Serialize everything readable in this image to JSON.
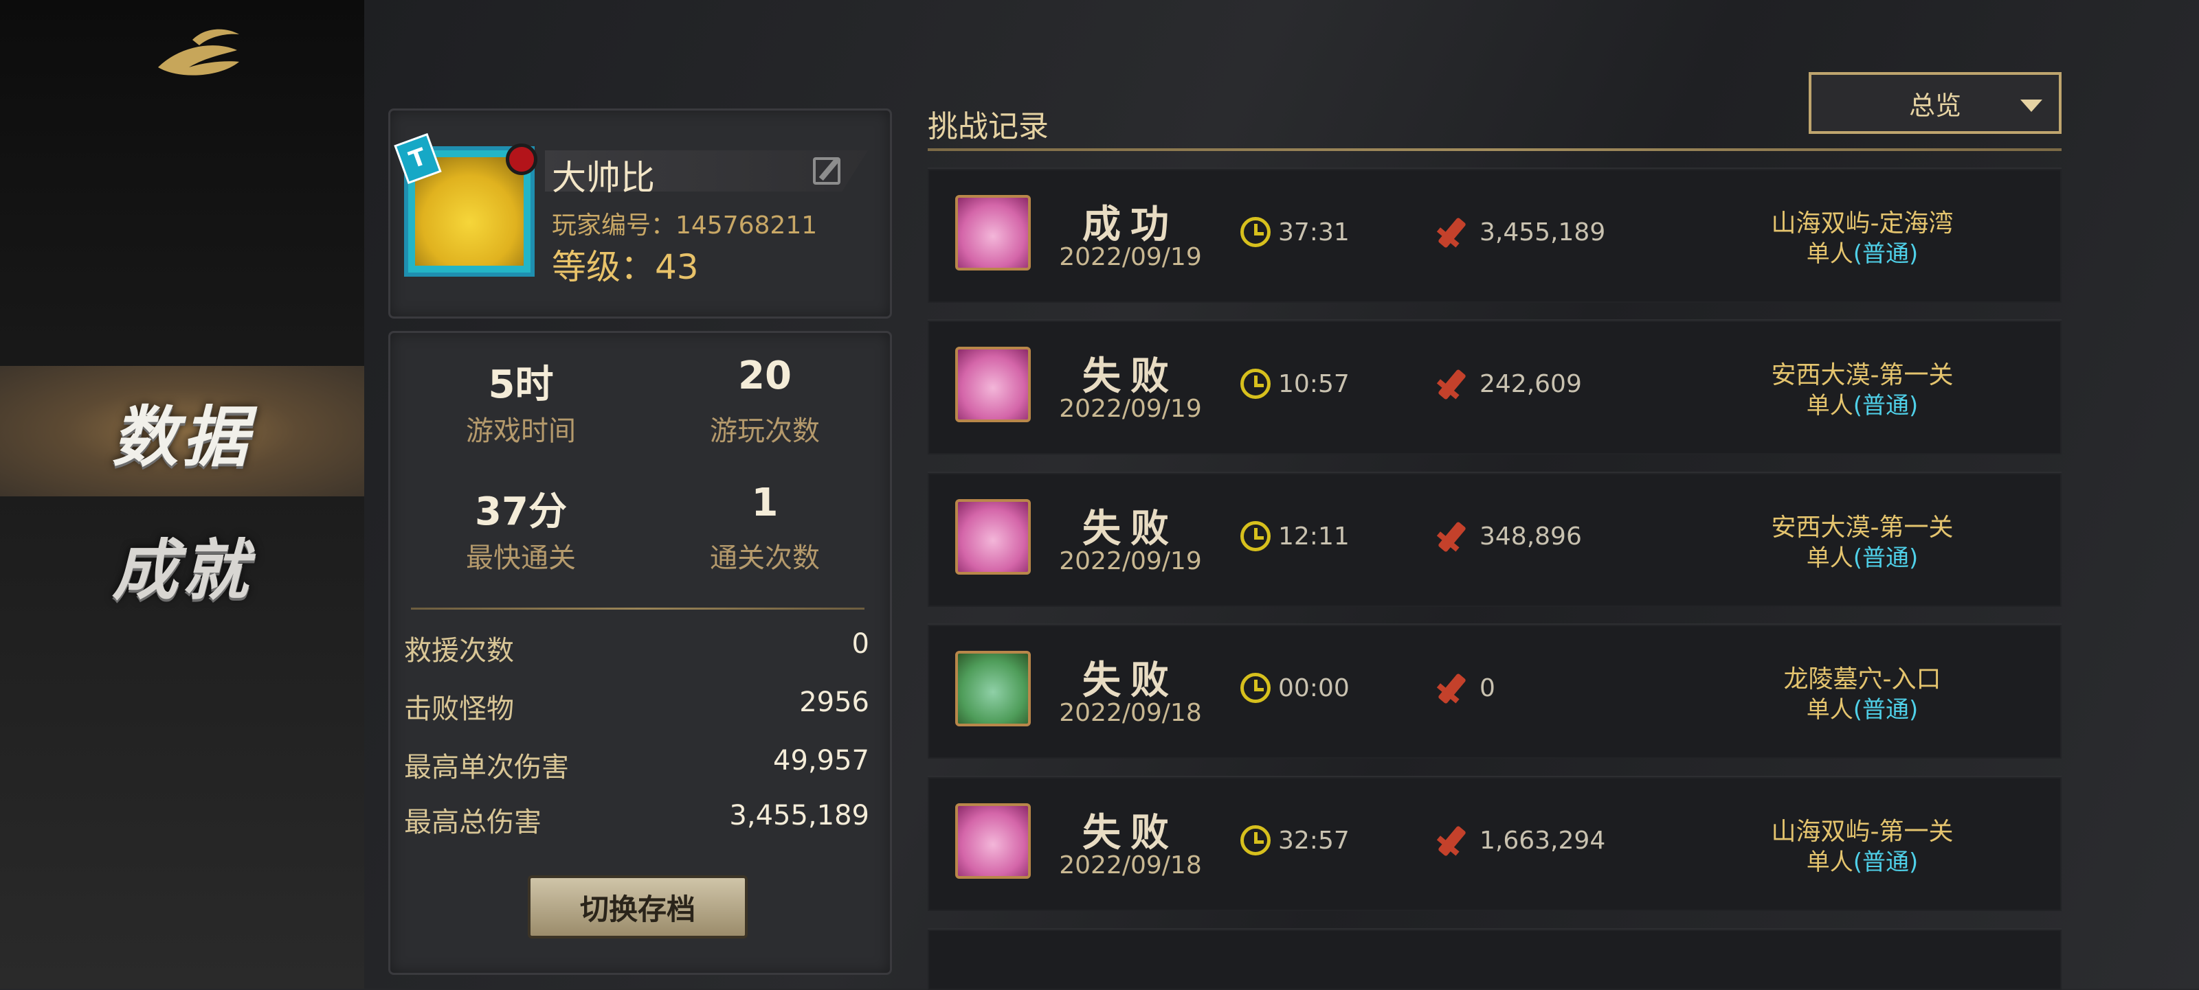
{
  "nav": {
    "data_label": "数据",
    "achievement_label": "成就"
  },
  "profile": {
    "name": "大帅比",
    "player_id": "玩家编号：145768211",
    "level": "等级：43",
    "avatar_tag": "T"
  },
  "stats": {
    "play_time": {
      "value": "5时",
      "label": "游戏时间"
    },
    "play_count": {
      "value": "20",
      "label": "游玩次数"
    },
    "fastest_clear": {
      "value": "37分",
      "label": "最快通关"
    },
    "clear_count": {
      "value": "1",
      "label": "通关次数"
    },
    "rows": [
      {
        "label": "救援次数",
        "value": "0"
      },
      {
        "label": "击败怪物",
        "value": "2956"
      },
      {
        "label": "最高单次伤害",
        "value": "49,957"
      },
      {
        "label": "最高总伤害",
        "value": "3,455,189"
      }
    ],
    "switch_button": "切换存档"
  },
  "records": {
    "title": "挑战记录",
    "filter": "总览",
    "items": [
      {
        "result": "成功",
        "date": "2022/09/19",
        "time": "37:31",
        "damage": "3,455,189",
        "stage": "山海双屿-定海湾",
        "mode_prefix": "单人",
        "mode": "(普通)",
        "avatar": "pink"
      },
      {
        "result": "失败",
        "date": "2022/09/19",
        "time": "10:57",
        "damage": "242,609",
        "stage": "安西大漠-第一关",
        "mode_prefix": "单人",
        "mode": "(普通)",
        "avatar": "pink"
      },
      {
        "result": "失败",
        "date": "2022/09/19",
        "time": "12:11",
        "damage": "348,896",
        "stage": "安西大漠-第一关",
        "mode_prefix": "单人",
        "mode": "(普通)",
        "avatar": "pink"
      },
      {
        "result": "失败",
        "date": "2022/09/18",
        "time": "00:00",
        "damage": "0",
        "stage": "龙陵墓穴-入口",
        "mode_prefix": "单人",
        "mode": "(普通)",
        "avatar": "green"
      },
      {
        "result": "失败",
        "date": "2022/09/18",
        "time": "32:57",
        "damage": "1,663,294",
        "stage": "山海双屿-第一关",
        "mode_prefix": "单人",
        "mode": "(普通)",
        "avatar": "pink"
      }
    ]
  }
}
